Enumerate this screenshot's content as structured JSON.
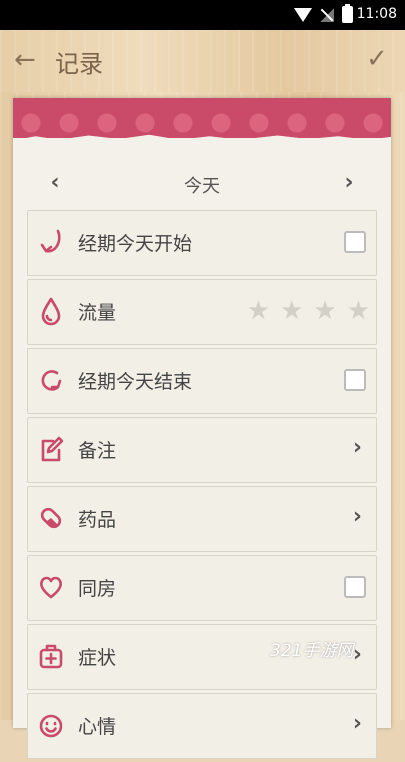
{
  "status_bar": {
    "time": "11:08"
  },
  "app_bar": {
    "title": "记录"
  },
  "day_nav": {
    "label": "今天"
  },
  "rows": [
    {
      "label": "经期今天开始",
      "icon": "period-start-icon",
      "control": "checkbox"
    },
    {
      "label": "流量",
      "icon": "drop-icon",
      "control": "stars",
      "stars_total": 4,
      "stars_filled": 0
    },
    {
      "label": "经期今天结束",
      "icon": "period-end-icon",
      "control": "checkbox"
    },
    {
      "label": "备注",
      "icon": "edit-icon",
      "control": "chevron"
    },
    {
      "label": "药品",
      "icon": "pill-icon",
      "control": "chevron"
    },
    {
      "label": "同房",
      "icon": "heart-icon",
      "control": "checkbox"
    },
    {
      "label": "症状",
      "icon": "medical-kit-icon",
      "control": "chevron"
    },
    {
      "label": "心情",
      "icon": "smiley-icon",
      "control": "chevron"
    }
  ],
  "watermark": "321手游网",
  "colors": {
    "accent": "#c94a69",
    "paper": "#f4f1ea",
    "wood": "#e9d5b6"
  }
}
